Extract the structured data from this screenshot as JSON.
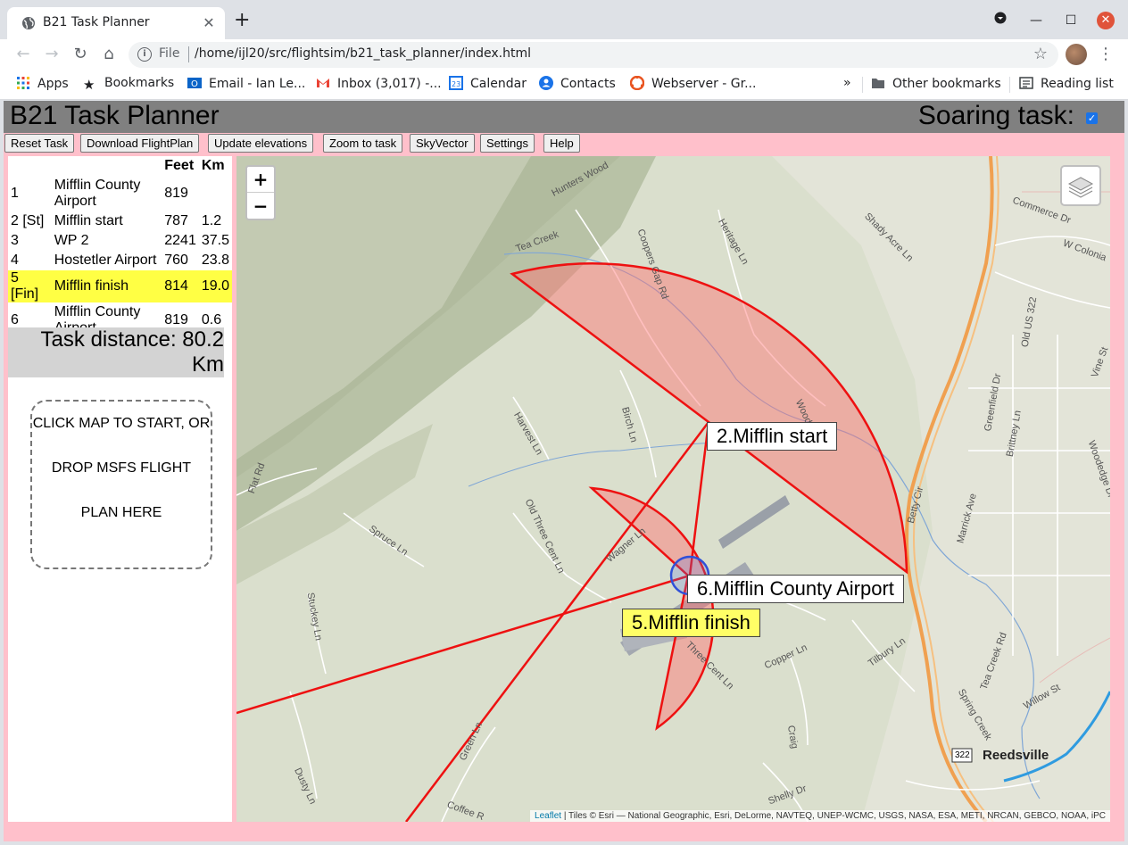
{
  "browser": {
    "tab_title": "B21 Task Planner",
    "url_scheme": "File",
    "url": "/home/ijl20/src/flightsim/b21_task_planner/index.html",
    "bookmarks": [
      "Apps",
      "Bookmarks",
      "Email - Ian Le...",
      "Inbox (3,017) -...",
      "Calendar",
      "Contacts",
      "Webserver - Gr...",
      "»",
      "Other bookmarks",
      "Reading list"
    ]
  },
  "header": {
    "title": "B21 Task Planner",
    "soaring_label": "Soaring task:",
    "soaring_checked": true
  },
  "buttons": [
    "Reset Task",
    "Download FlightPlan",
    "Update elevations",
    "Zoom to task",
    "SkyVector",
    "Settings",
    "Help"
  ],
  "table": {
    "headers": [
      "",
      "",
      "Feet",
      "Km"
    ],
    "rows": [
      {
        "idx": "1",
        "name": "Mifflin County Airport",
        "feet": "819",
        "km": ""
      },
      {
        "idx": "2 [St]",
        "name": "Mifflin start",
        "feet": "787",
        "km": "1.2"
      },
      {
        "idx": "3",
        "name": "WP 2",
        "feet": "2241",
        "km": "37.5"
      },
      {
        "idx": "4",
        "name": "Hostetler Airport",
        "feet": "760",
        "km": "23.8"
      },
      {
        "idx": "5 [Fin]",
        "name": "Mifflin finish",
        "feet": "814",
        "km": "19.0"
      },
      {
        "idx": "6",
        "name": "Mifflin County Airport",
        "feet": "819",
        "km": "0.6"
      }
    ],
    "highlighted_row": 4
  },
  "task_distance": "Task distance: 80.2 Km",
  "dropzone": [
    "CLICK MAP TO START, OR",
    "DROP MSFS FLIGHT",
    "PLAN HERE"
  ],
  "map": {
    "zoom_in": "+",
    "zoom_out": "−",
    "labels": {
      "start": "2.Mifflin start",
      "airport": "6.Mifflin County Airport",
      "finish": "5.Mifflin finish"
    },
    "town": "Reedsville",
    "shield": "322",
    "attribution_link": "Leaflet",
    "attribution_text": " | Tiles © Esri — National Geographic, Esri, DeLorme, NAVTEQ, UNEP-WCMC, USGS, NASA, ESA, METI, NRCAN, GEBCO, NOAA, iPC",
    "road_names": [
      "Hunters Wood",
      "Tea Creek",
      "Coopers Gap Rd",
      "Heritage Ln",
      "Shady Acre Ln",
      "Commerce Dr",
      "W Colonia",
      "Old US 322",
      "Vine St",
      "Birch Ln",
      "Harvest Ln",
      "Woodland",
      "Greenfield Dr",
      "Brittney Ln",
      "Woodedge Dr",
      "Flat Rd",
      "Old Three Cent Ln",
      "Spruce Ln",
      "Wagner Ln",
      "Betty Cir",
      "Marrick Ave",
      "Stuckey Ln",
      "Three Cent Ln",
      "Copper Ln",
      "Tilbury Ln",
      "Tea Creek Rd",
      "Spring Creek",
      "Willow St",
      "Green Ln",
      "Craig",
      "Dusty Ln",
      "Coffee R",
      "Shelly Dr"
    ],
    "colors": {
      "sector_stroke": "#ee1111",
      "sector_fill": "#ff8080",
      "page_bg": "#ffc0cb"
    }
  }
}
